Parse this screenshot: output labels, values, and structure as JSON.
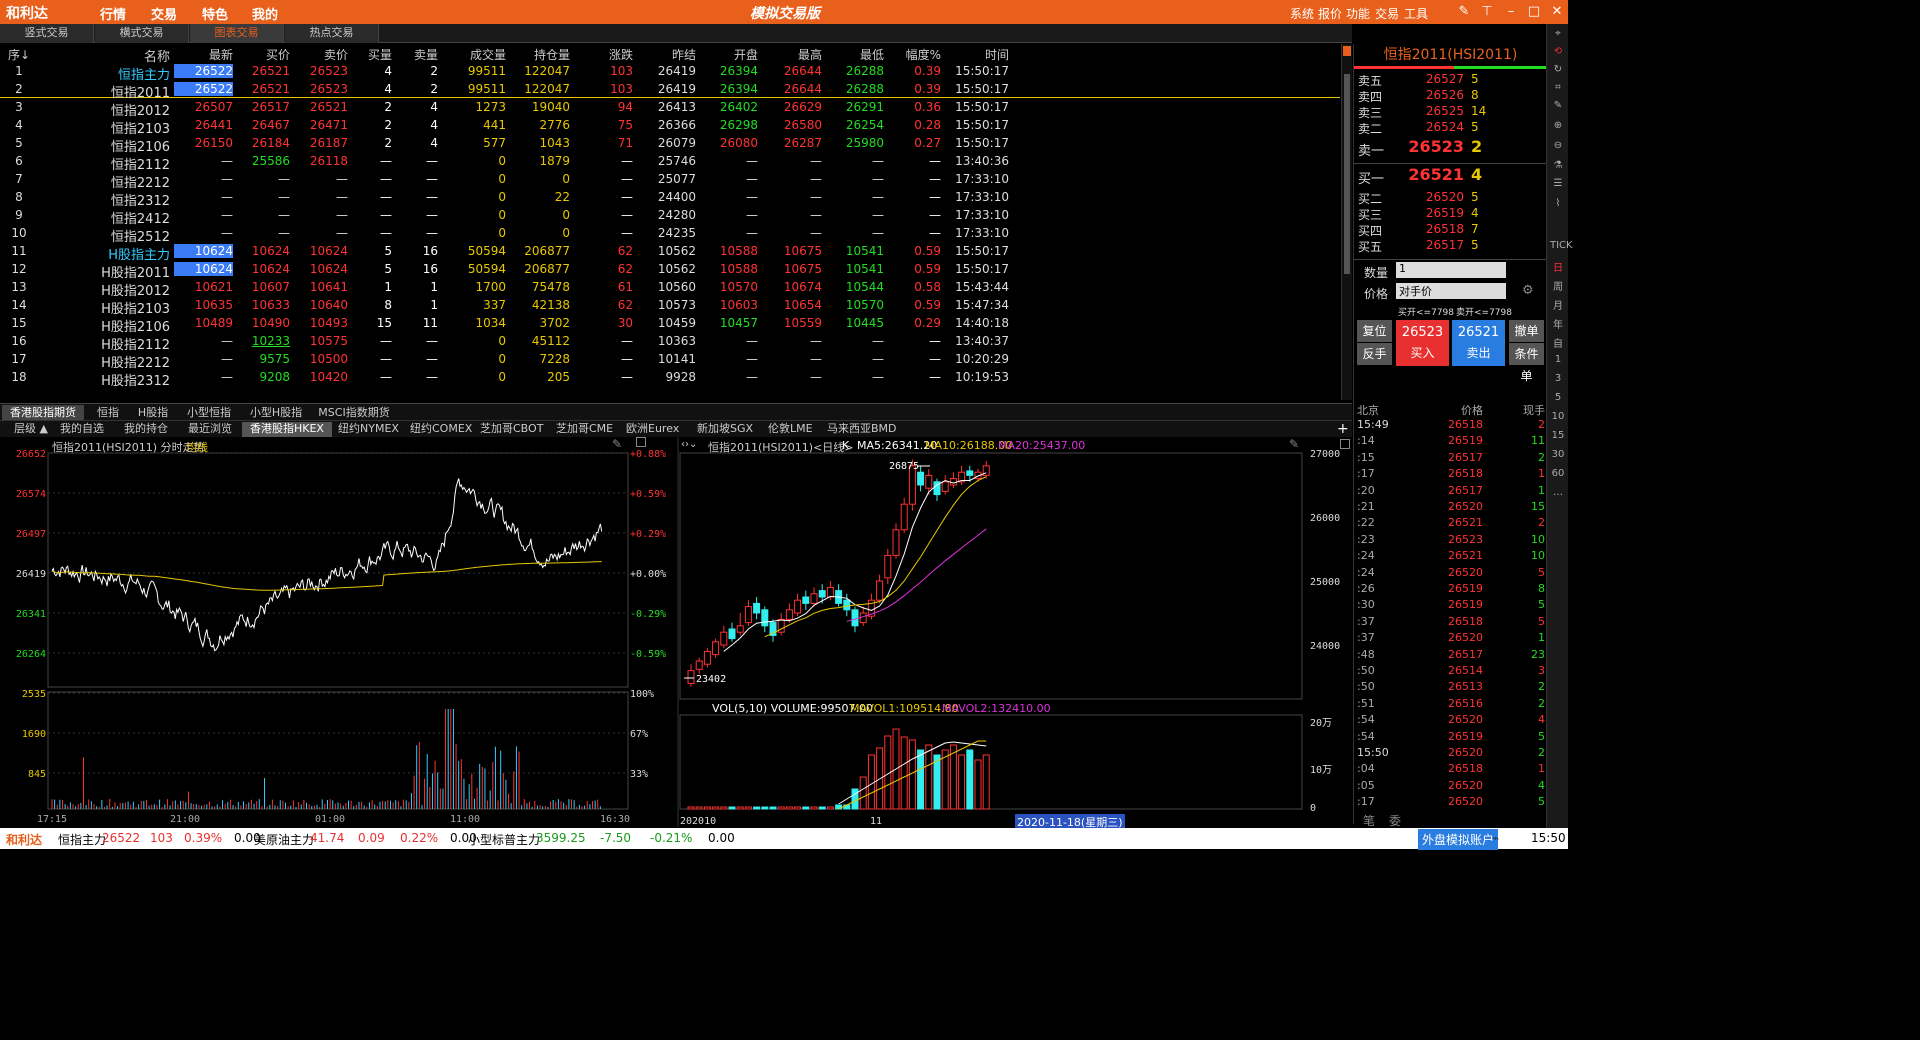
{
  "titlebar": {
    "logo": "和利达",
    "menus": [
      "行情",
      "交易",
      "特色",
      "我的"
    ],
    "title": "模拟交易版",
    "sys_menus": [
      "系统",
      "报价",
      "功能",
      "交易",
      "工具"
    ]
  },
  "tabs": [
    "竖式交易",
    "横式交易",
    "图表交易",
    "热点交易"
  ],
  "table": {
    "headers": [
      "序↓",
      "名称",
      "最新",
      "买价",
      "卖价",
      "买量",
      "卖量",
      "成交量",
      "持仓量",
      "涨跌",
      "昨结",
      "开盘",
      "最高",
      "最低",
      "幅度%",
      "时间"
    ],
    "rows": [
      [
        "1",
        "恒指主力",
        "26522",
        "26521",
        "26523",
        "4",
        "2",
        "99511",
        "122047",
        "103",
        "26419",
        "26394",
        "26644",
        "26288",
        "0.39",
        "15:50:17"
      ],
      [
        "2",
        "恒指2011",
        "26522",
        "26521",
        "26523",
        "4",
        "2",
        "99511",
        "122047",
        "103",
        "26419",
        "26394",
        "26644",
        "26288",
        "0.39",
        "15:50:17"
      ],
      [
        "3",
        "恒指2012",
        "26507",
        "26517",
        "26521",
        "2",
        "4",
        "1273",
        "19040",
        "94",
        "26413",
        "26402",
        "26629",
        "26291",
        "0.36",
        "15:50:17"
      ],
      [
        "4",
        "恒指2103",
        "26441",
        "26467",
        "26471",
        "2",
        "4",
        "441",
        "2776",
        "75",
        "26366",
        "26298",
        "26580",
        "26254",
        "0.28",
        "15:50:17"
      ],
      [
        "5",
        "恒指2106",
        "26150",
        "26184",
        "26187",
        "2",
        "4",
        "577",
        "1043",
        "71",
        "26079",
        "26080",
        "26287",
        "25980",
        "0.27",
        "15:50:17"
      ],
      [
        "6",
        "恒指2112",
        "—",
        "25586",
        "26118",
        "—",
        "—",
        "0",
        "1879",
        "—",
        "25746",
        "—",
        "—",
        "—",
        "—",
        "13:40:36"
      ],
      [
        "7",
        "恒指2212",
        "—",
        "—",
        "—",
        "—",
        "—",
        "0",
        "0",
        "—",
        "25077",
        "—",
        "—",
        "—",
        "—",
        "17:33:10"
      ],
      [
        "8",
        "恒指2312",
        "—",
        "—",
        "—",
        "—",
        "—",
        "0",
        "22",
        "—",
        "24400",
        "—",
        "—",
        "—",
        "—",
        "17:33:10"
      ],
      [
        "9",
        "恒指2412",
        "—",
        "—",
        "—",
        "—",
        "—",
        "0",
        "0",
        "—",
        "24280",
        "—",
        "—",
        "—",
        "—",
        "17:33:10"
      ],
      [
        "10",
        "恒指2512",
        "—",
        "—",
        "—",
        "—",
        "—",
        "0",
        "0",
        "—",
        "24235",
        "—",
        "—",
        "—",
        "—",
        "17:33:10"
      ],
      [
        "11",
        "H股指主力",
        "10624",
        "10624",
        "10624",
        "5",
        "16",
        "50594",
        "206877",
        "62",
        "10562",
        "10588",
        "10675",
        "10541",
        "0.59",
        "15:50:17"
      ],
      [
        "12",
        "H股指2011",
        "10624",
        "10624",
        "10624",
        "5",
        "16",
        "50594",
        "206877",
        "62",
        "10562",
        "10588",
        "10675",
        "10541",
        "0.59",
        "15:50:17"
      ],
      [
        "13",
        "H股指2012",
        "10621",
        "10607",
        "10641",
        "1",
        "1",
        "1700",
        "75478",
        "61",
        "10560",
        "10570",
        "10674",
        "10544",
        "0.58",
        "15:43:44"
      ],
      [
        "14",
        "H股指2103",
        "10635",
        "10633",
        "10640",
        "8",
        "1",
        "337",
        "42138",
        "62",
        "10573",
        "10603",
        "10654",
        "10570",
        "0.59",
        "15:47:34"
      ],
      [
        "15",
        "H股指2106",
        "10489",
        "10490",
        "10493",
        "15",
        "11",
        "1034",
        "3702",
        "30",
        "10459",
        "10457",
        "10559",
        "10445",
        "0.29",
        "14:40:18"
      ],
      [
        "16",
        "H股指2112",
        "—",
        "10233",
        "10575",
        "—",
        "—",
        "0",
        "45112",
        "—",
        "10363",
        "—",
        "—",
        "—",
        "—",
        "13:40:37"
      ],
      [
        "17",
        "H股指2212",
        "—",
        "9575",
        "10500",
        "—",
        "—",
        "0",
        "7228",
        "—",
        "10141",
        "—",
        "—",
        "—",
        "—",
        "10:20:29"
      ],
      [
        "18",
        "H股指2312",
        "—",
        "9208",
        "10420",
        "—",
        "—",
        "0",
        "205",
        "—",
        "9928",
        "—",
        "—",
        "—",
        "—",
        "10:19:53"
      ]
    ]
  },
  "orderbook": {
    "title": "恒指2011(HSI2011)",
    "asks": [
      [
        "卖五",
        "26527",
        "5"
      ],
      [
        "卖四",
        "26526",
        "8"
      ],
      [
        "卖三",
        "26525",
        "14"
      ],
      [
        "卖二",
        "26524",
        "5"
      ],
      [
        "卖一",
        "26523",
        "2"
      ]
    ],
    "bids": [
      [
        "买一",
        "26521",
        "4"
      ],
      [
        "买二",
        "26520",
        "5"
      ],
      [
        "买三",
        "26519",
        "4"
      ],
      [
        "买四",
        "26518",
        "7"
      ],
      [
        "买五",
        "26517",
        "5"
      ]
    ],
    "qty_label": "数量",
    "qty_value": "1",
    "price_label": "价格",
    "price_value": "对手价",
    "buy_open": "买开<=7798",
    "sell_open": "卖开<=7798",
    "btn_reset": "复位",
    "btn_reverse": "反手",
    "buy_price": "26523",
    "buy_label": "买入",
    "sell_price": "26521",
    "sell_label": "卖出",
    "btn_cancel": "撤单",
    "btn_cond": "条件单"
  },
  "ticks": {
    "headers": [
      "北京",
      "价格",
      "现手"
    ],
    "rows": [
      [
        "15:49",
        "26518",
        "2"
      ],
      [
        ":14",
        "26519",
        "11"
      ],
      [
        ":15",
        "26517",
        "2"
      ],
      [
        ":17",
        "26518",
        "1"
      ],
      [
        ":20",
        "26517",
        "1"
      ],
      [
        ":21",
        "26520",
        "15"
      ],
      [
        ":22",
        "26521",
        "2"
      ],
      [
        ":23",
        "26523",
        "10"
      ],
      [
        ":24",
        "26521",
        "10"
      ],
      [
        ":24",
        "26520",
        "5"
      ],
      [
        ":26",
        "26519",
        "8"
      ],
      [
        ":30",
        "26519",
        "5"
      ],
      [
        ":37",
        "26518",
        "5"
      ],
      [
        ":37",
        "26520",
        "1"
      ],
      [
        ":48",
        "26517",
        "23"
      ],
      [
        ":50",
        "26514",
        "3"
      ],
      [
        ":50",
        "26513",
        "2"
      ],
      [
        ":51",
        "26516",
        "2"
      ],
      [
        ":54",
        "26520",
        "4"
      ],
      [
        ":54",
        "26519",
        "5"
      ],
      [
        "15:50",
        "26520",
        "2"
      ],
      [
        ":04",
        "26518",
        "1"
      ],
      [
        ":05",
        "26520",
        "4"
      ],
      [
        ":17",
        "26520",
        "5"
      ]
    ],
    "bottom": [
      "笔",
      "委"
    ]
  },
  "cat_tabs": [
    "香港股指期货",
    "恒指",
    "H股指",
    "小型恒指",
    "小型H股指",
    "MSCI指数期货"
  ],
  "ex_tabs": [
    "层级 ▲",
    "我的自选",
    "我的持仓",
    "最近浏览",
    "香港股指HKEX",
    "纽约NYMEX",
    "纽约COMEX",
    "芝加哥CBOT",
    "芝加哥CME",
    "欧洲Eurex",
    "新加坡SGX",
    "伦敦LME",
    "马来西亚BMD"
  ],
  "chart_data": [
    {
      "type": "line",
      "title": "恒指2011(HSI2011) 分时走势",
      "legend": "均线",
      "y_ticks": [
        "26652",
        "26574",
        "26497",
        "26419",
        "26341",
        "26264"
      ],
      "pct_ticks": [
        "+0.88%",
        "+0.59%",
        "+0.29%",
        "+0.00%",
        "-0.29%",
        "-0.59%"
      ],
      "vol_ticks": [
        "2535",
        "1690",
        "845"
      ],
      "vol_pct": [
        "100%",
        "67%",
        "33%"
      ],
      "x_ticks": [
        "17:15",
        "21:00",
        "01:00",
        "11:00",
        "16:30"
      ],
      "ylim": [
        26187,
        26652
      ]
    },
    {
      "type": "candlestick",
      "title": "恒指2011(HSI2011)<日线>",
      "period": "K",
      "ma5": "MA5:26341.20",
      "ma10": "MA10:26188.00",
      "ma20": "MA20:25437.00",
      "high_label": "26875",
      "low_label": "23402",
      "y_ticks": [
        "27000",
        "26000",
        "25000",
        "24000"
      ],
      "vol_title": "VOL(5,10) VOLUME:99507.00",
      "mavol1": "MAVOL1:109514.80",
      "mavol2": "MAVOL2:132410.00",
      "vol_ticks": [
        "20万",
        "10万",
        "0"
      ],
      "x_ticks": [
        "202010",
        "11"
      ],
      "date_label": "2020-11-18(星期三)"
    }
  ],
  "statusbar": {
    "logo": "和利达",
    "items": [
      [
        "恒指主力",
        "26522",
        "103",
        "0.39%",
        "0.00"
      ],
      [
        "美原油主力",
        "41.74",
        "0.09",
        "0.22%",
        "0.00"
      ],
      [
        "小型标普主力",
        "3599.25",
        "-7.50",
        "-0.21%",
        "0.00"
      ]
    ],
    "account": "外盘模拟账户",
    "time": "15:50"
  },
  "sidebar": [
    "TICK",
    "日",
    "周",
    "月",
    "年",
    "自",
    "1",
    "3",
    "5",
    "10",
    "15",
    "30",
    "60",
    "…"
  ]
}
